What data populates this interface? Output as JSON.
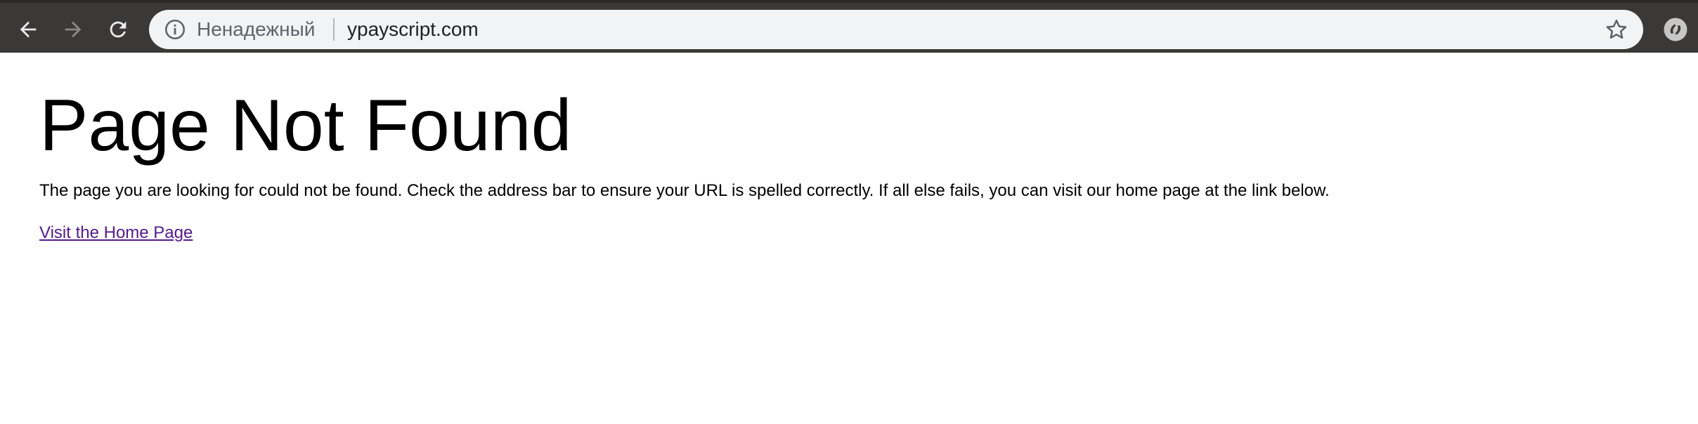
{
  "browser": {
    "security_label": "Ненадежный",
    "url": "ypayscript.com",
    "icons": {
      "back": "back-arrow-icon",
      "forward": "forward-arrow-icon",
      "reload": "reload-icon",
      "info": "info-icon",
      "bookmark": "star-icon",
      "extension": "extension-icon"
    },
    "colors": {
      "toolbar": "#3b3937",
      "omnibox": "#f1f3f4",
      "forward_disabled": "#8a8886"
    }
  },
  "page": {
    "title": "Page Not Found",
    "message": "The page you are looking for could not be found. Check the address bar to ensure your URL is spelled correctly. If all else fails, you can visit our home page at the link below.",
    "home_link": "Visit the Home Page",
    "colors": {
      "link_visited": "#551a8b"
    }
  }
}
